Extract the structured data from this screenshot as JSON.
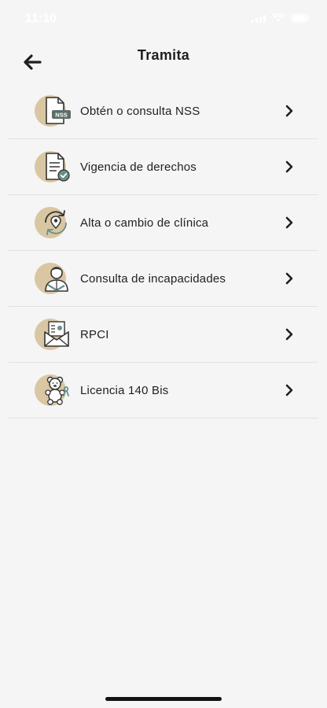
{
  "status_bar": {
    "time": "11:10"
  },
  "header": {
    "title": "Tramita"
  },
  "menu": {
    "items": [
      {
        "label": "Obtén o consulta NSS",
        "icon": "nss-document-icon",
        "badge": "NSS"
      },
      {
        "label": "Vigencia de derechos",
        "icon": "document-check-icon"
      },
      {
        "label": "Alta o cambio de clínica",
        "icon": "location-refresh-icon"
      },
      {
        "label": "Consulta de incapacidades",
        "icon": "injured-person-icon"
      },
      {
        "label": "RPCI",
        "icon": "envelope-document-icon"
      },
      {
        "label": "Licencia 140 Bis",
        "icon": "teddy-bear-ribbon-icon"
      }
    ]
  },
  "colors": {
    "background": "#f5f5f5",
    "icon_circle": "#d9c7a3",
    "icon_stroke": "#333333",
    "accent_check": "#6a8f8a",
    "divider": "#e2e2e2"
  }
}
